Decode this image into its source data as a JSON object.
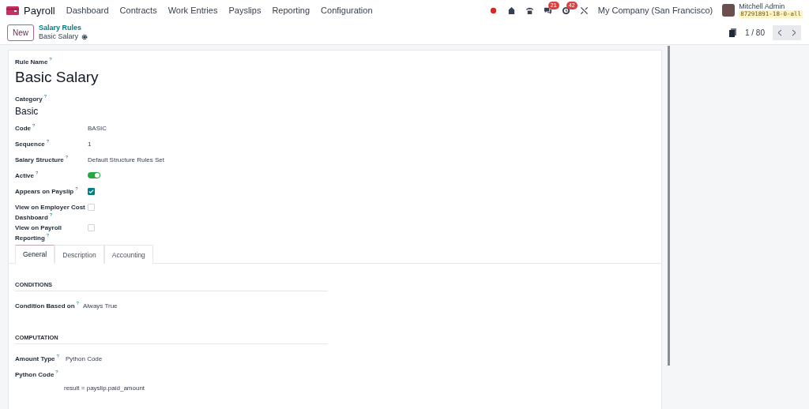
{
  "navbar": {
    "app_name": "Payroll",
    "menu": [
      "Dashboard",
      "Contracts",
      "Work Entries",
      "Payslips",
      "Reporting",
      "Configuration"
    ],
    "badges": {
      "messages": "21",
      "activities": "42"
    },
    "company": "My Company (San Francisco)",
    "user": {
      "name": "Mitchell Admin",
      "database": "87291891-18-0-all"
    }
  },
  "control_panel": {
    "new_button": "New",
    "breadcrumb": "Salary Rules",
    "current": "Basic Salary",
    "pager": "1 / 80"
  },
  "form": {
    "rule_name": {
      "label": "Rule Name",
      "hint": "?",
      "value": "Basic Salary"
    },
    "category": {
      "label": "Category",
      "hint": "?",
      "value": "Basic"
    },
    "fields": [
      {
        "kind": "text",
        "label": "Code",
        "hint": "?",
        "value": "BASIC"
      },
      {
        "kind": "text",
        "label": "Sequence",
        "hint": "?",
        "value": "1"
      },
      {
        "kind": "text",
        "label": "Salary Structure",
        "hint": "?",
        "value": "Default Structure Rules Set"
      },
      {
        "kind": "toggle",
        "label": "Active",
        "hint": "?",
        "on": true
      },
      {
        "kind": "checkbox",
        "label": "Appears on Payslip",
        "hint": "?",
        "checked": true
      },
      {
        "kind": "checkbox",
        "label": "View on Employer Cost Dashboard",
        "hint": "?",
        "checked": false
      },
      {
        "kind": "checkbox",
        "label": "View on Payroll Reporting",
        "hint": "?",
        "checked": false
      }
    ],
    "tabs": [
      {
        "label": "General",
        "selected": true
      },
      {
        "label": "Description",
        "selected": false
      },
      {
        "label": "Accounting",
        "selected": false
      }
    ],
    "sections": [
      {
        "title": "CONDITIONS",
        "fields": [
          {
            "kind": "text",
            "label": "Condition Based on",
            "hint": "?",
            "value": "Always True"
          }
        ]
      },
      {
        "title": "COMPUTATION",
        "fields": [
          {
            "kind": "text",
            "label": "Amount Type",
            "hint": "?",
            "value": "Python Code"
          },
          {
            "kind": "code",
            "label": "Python Code",
            "hint": "?",
            "value": "result = payslip.paid_amount"
          }
        ]
      }
    ]
  }
}
